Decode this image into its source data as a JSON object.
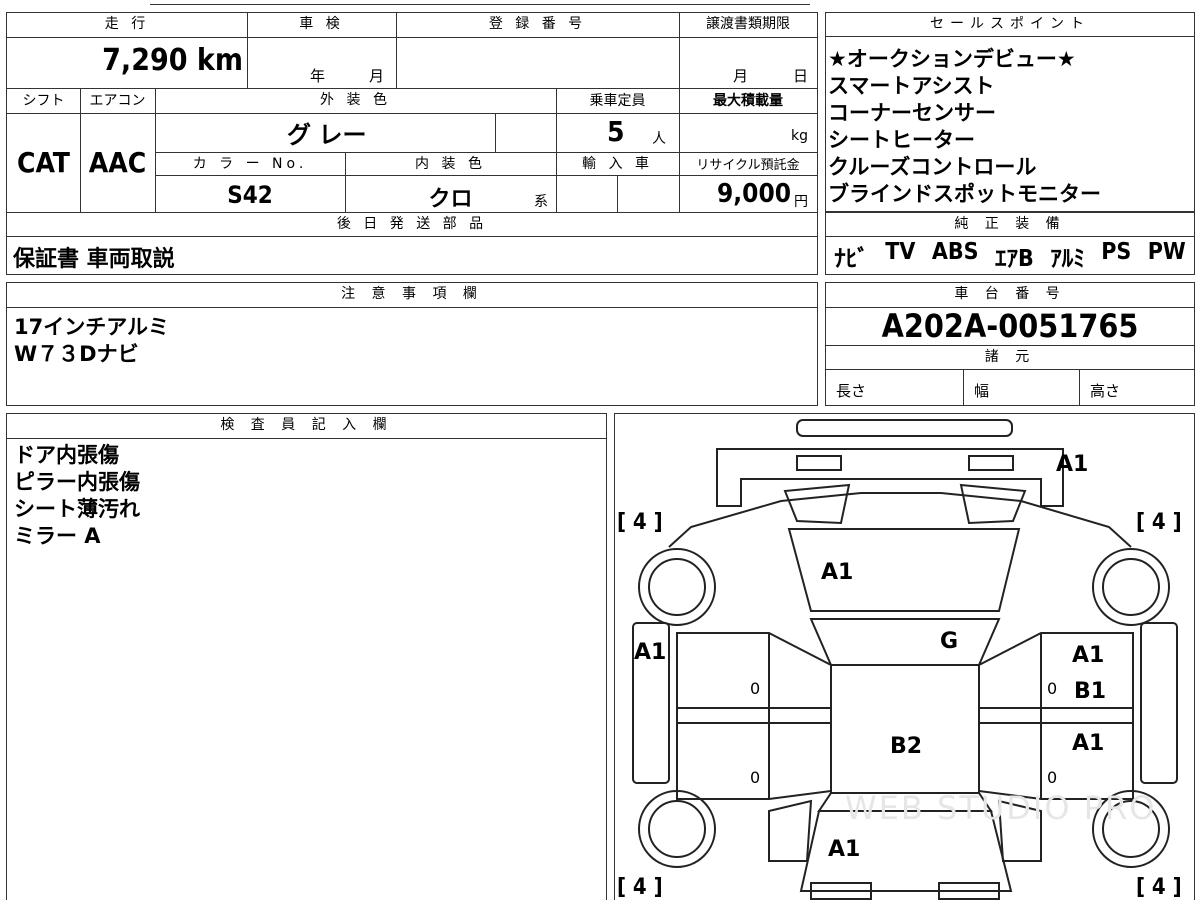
{
  "top": {
    "mileage_header": "走 行",
    "mileage_value": "7,290 km",
    "inspection_header": "車 検",
    "inspection_year": "年",
    "inspection_month": "月",
    "registration_header": "登 録 番 号",
    "transfer_header": "譲渡書類期限",
    "transfer_month": "月",
    "transfer_day": "日",
    "shift_header": "シフト",
    "shift_value": "CAT",
    "ac_header": "エアコン",
    "ac_value": "AAC",
    "exterior_header": "外 装 色",
    "exterior_value": "グ レー",
    "capacity_header": "乗車定員",
    "capacity_value": "5",
    "capacity_unit": "人",
    "maxload_header": "最大積載量",
    "maxload_unit": "kg",
    "colorno_header": "カ ラ ー No.",
    "colorno_value": "S42",
    "interior_header": "内 装 色",
    "interior_value": "クロ",
    "interior_unit": "系",
    "import_header": "輸 入 車",
    "recycle_header": "リサイクル預託金",
    "recycle_value": "9,000",
    "recycle_unit": "円",
    "later_header": "後 日 発 送 部 品",
    "later_value": "保証書 車両取説"
  },
  "sales": {
    "header": "セールスポイント",
    "items": [
      "★オークションデビュー★",
      "スマートアシスト",
      "コーナーセンサー",
      "シートヒーター",
      "クルーズコントロール",
      "ブラインドスポットモニター"
    ]
  },
  "equipment": {
    "header": "純 正 装 備",
    "items": [
      "ﾅﾋﾞ",
      "TV",
      "ABS",
      "ｴｱB",
      "ｱﾙﾐ",
      "PS",
      "PW"
    ]
  },
  "notes": {
    "header": "注 意 事 項 欄",
    "lines": [
      "17インチアルミ",
      "W７３Dナビ"
    ]
  },
  "chassis": {
    "header": "車 台 番 号",
    "value": "A202A-0051765",
    "specs_header": "諸 元",
    "length": "長さ",
    "width": "幅",
    "height": "高さ"
  },
  "inspector": {
    "header": "検 査 員 記 入 欄",
    "lines": [
      "ドア内張傷",
      "ピラー内張傷",
      "シート薄汚れ",
      "ミラー A"
    ]
  },
  "diagram": {
    "marks": {
      "front_bumper": "A1",
      "hood": "A1",
      "windshield": "G",
      "left_fender": "A1",
      "right_front_door": "A1",
      "right_pillar": "B1",
      "roof": "B2",
      "right_rear_door": "A1",
      "rear_window": "A1"
    },
    "tire_front_left": "[ 4 ]",
    "tire_front_right": "[ 4 ]",
    "tire_rear_left": "[ 4 ]",
    "tire_rear_right": "[ 4 ]",
    "door_zero": "0",
    "watermark": "WEB STUDIO PRO"
  }
}
